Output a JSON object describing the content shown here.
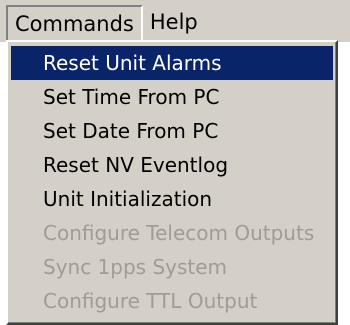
{
  "menubar": {
    "items": [
      {
        "label": "Commands"
      },
      {
        "label": "Help"
      }
    ]
  },
  "dropdown": {
    "items": [
      {
        "label": "Reset Unit Alarms"
      },
      {
        "label": "Set Time From PC"
      },
      {
        "label": "Set Date From PC"
      },
      {
        "label": "Reset NV Eventlog"
      },
      {
        "label": "Unit Initialization"
      },
      {
        "label": "Configure Telecom Outputs"
      },
      {
        "label": "Sync 1pps System"
      },
      {
        "label": "Configure TTL Output"
      }
    ]
  },
  "colors": {
    "menu_bg": "#d4d0c8",
    "highlight": "#0a246a",
    "disabled_text": "#a09c94"
  }
}
